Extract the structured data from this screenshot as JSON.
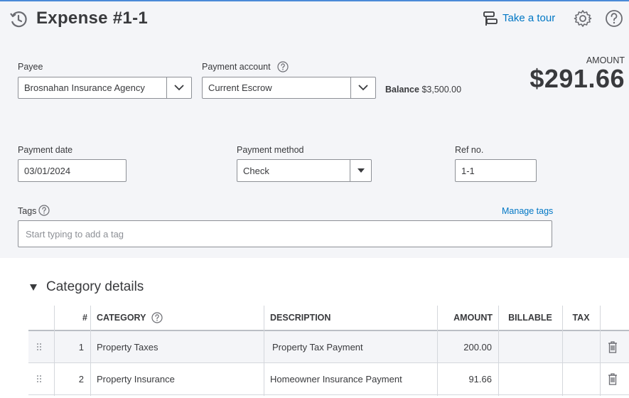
{
  "header": {
    "title": "Expense #1-1",
    "take_tour": "Take a tour",
    "icons": [
      "history-icon",
      "tour-icon",
      "gear-icon",
      "help-icon"
    ]
  },
  "form": {
    "payee": {
      "label": "Payee",
      "value": "Brosnahan Insurance Agency"
    },
    "payment_account": {
      "label": "Payment account",
      "value": "Current Escrow"
    },
    "balance": {
      "label": "Balance",
      "value": "$3,500.00"
    },
    "amount": {
      "label": "AMOUNT",
      "value": "$291.66"
    },
    "payment_date": {
      "label": "Payment date",
      "value": "03/01/2024"
    },
    "payment_method": {
      "label": "Payment method",
      "value": "Check"
    },
    "ref_no": {
      "label": "Ref no.",
      "value": "1-1"
    },
    "tags": {
      "label": "Tags",
      "placeholder": "Start typing to add a tag",
      "manage_link": "Manage tags"
    }
  },
  "category_details": {
    "title": "Category details",
    "columns": [
      "#",
      "CATEGORY",
      "DESCRIPTION",
      "AMOUNT",
      "BILLABLE",
      "TAX"
    ],
    "rows": [
      {
        "num": "1",
        "category": "Property Taxes",
        "description": "Property Tax Payment",
        "amount": "200.00"
      },
      {
        "num": "2",
        "category": "Property Insurance",
        "description": "Homeowner Insurance Payment",
        "amount": "91.66"
      }
    ]
  },
  "colors": {
    "accent": "#0077c5",
    "background": "#f4f5f8",
    "text": "#393a3d",
    "border": "#8d9096"
  }
}
